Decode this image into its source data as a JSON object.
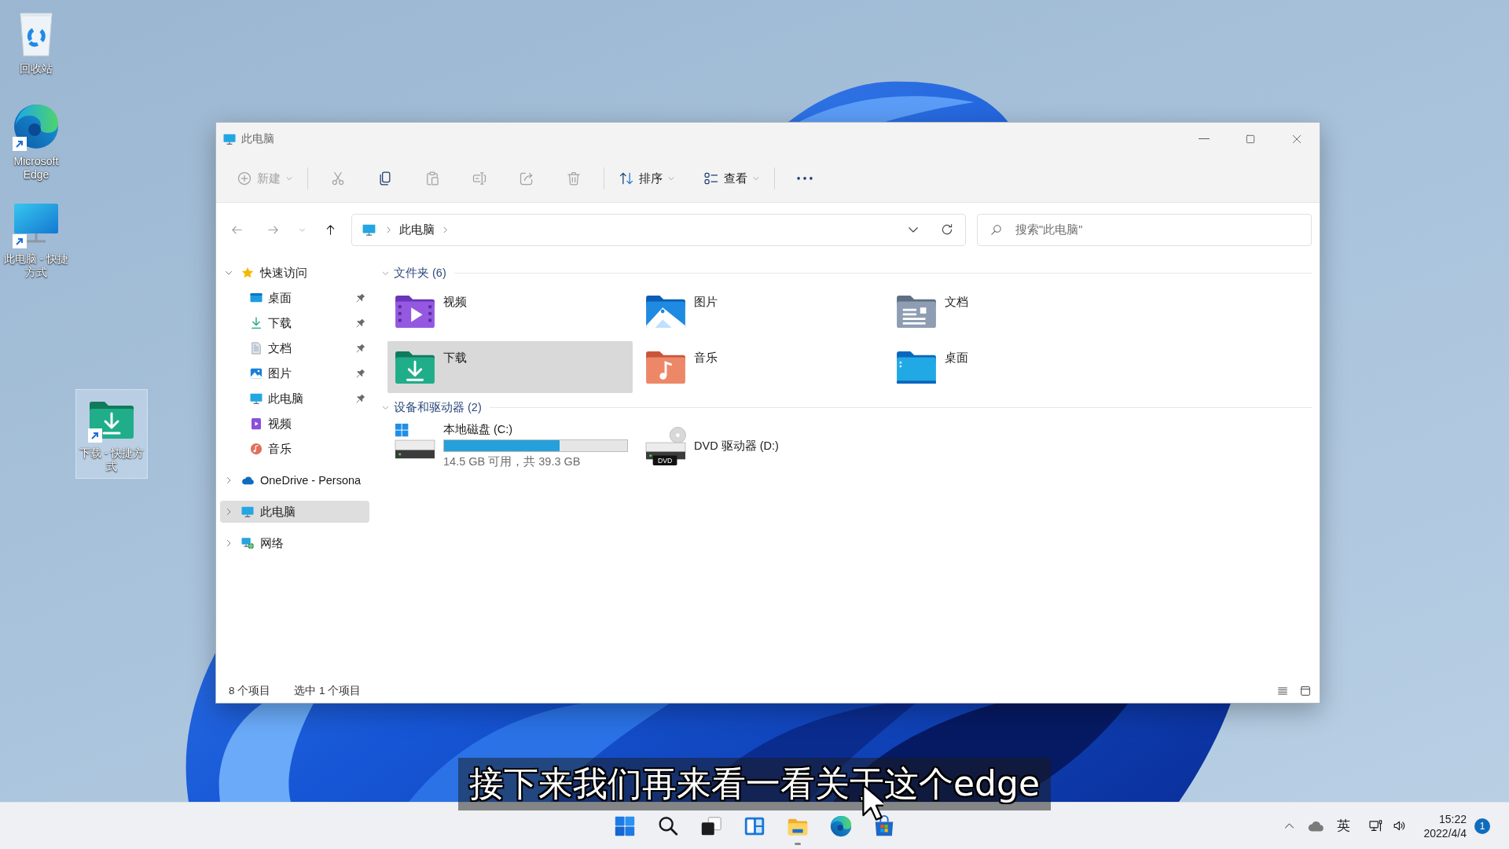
{
  "desktop": {
    "icons": [
      {
        "label": "回收站",
        "kind": "recycle-bin",
        "shortcut": false,
        "selected": false
      },
      {
        "label": "Microsoft Edge",
        "kind": "edge",
        "shortcut": true,
        "selected": false
      },
      {
        "label": "此电脑 - 快捷方式",
        "kind": "pc",
        "shortcut": true,
        "selected": false
      },
      {
        "label": "下载 - 快捷方式",
        "kind": "downloads",
        "shortcut": true,
        "selected": true
      }
    ]
  },
  "window": {
    "title": "此电脑",
    "controls": [
      {
        "kind": "minimize"
      },
      {
        "kind": "maximize"
      },
      {
        "kind": "close"
      }
    ],
    "toolbar": [
      {
        "buttons": [
          {
            "kind": "new",
            "label": "新建",
            "dropdown": true,
            "disabled": true
          }
        ]
      },
      {
        "buttons": [
          {
            "kind": "cut",
            "disabled": true
          },
          {
            "kind": "copy",
            "disabled": false
          },
          {
            "kind": "paste",
            "disabled": true
          },
          {
            "kind": "rename",
            "disabled": true
          },
          {
            "kind": "share",
            "disabled": true
          },
          {
            "kind": "delete",
            "disabled": true
          }
        ]
      },
      {
        "buttons": [
          {
            "kind": "sort",
            "label": "排序",
            "dropdown": true,
            "disabled": false
          },
          {
            "kind": "view",
            "label": "查看",
            "dropdown": true,
            "disabled": false
          }
        ]
      },
      {
        "buttons": [
          {
            "kind": "more",
            "disabled": false
          }
        ]
      }
    ],
    "nav": [
      {
        "kind": "back",
        "disabled": true
      },
      {
        "kind": "forward",
        "disabled": true
      },
      {
        "kind": "recent",
        "disabled": true
      },
      {
        "kind": "up",
        "disabled": false
      }
    ],
    "address": {
      "path": [
        "此电脑"
      ]
    },
    "search": {
      "placeholder": "搜索\"此电脑\""
    },
    "sidebar": {
      "items": [
        {
          "label": "快速访问",
          "kind": "star",
          "expanded": true,
          "selected": false,
          "children": [
            {
              "label": "桌面",
              "kind": "desktop",
              "pinned": true,
              "selected": false
            },
            {
              "label": "下载",
              "kind": "downloads",
              "pinned": true,
              "selected": false
            },
            {
              "label": "文档",
              "kind": "documents",
              "pinned": true,
              "selected": false
            },
            {
              "label": "图片",
              "kind": "pictures",
              "pinned": true,
              "selected": false
            },
            {
              "label": "此电脑",
              "kind": "pc",
              "pinned": true,
              "selected": false
            },
            {
              "label": "视频",
              "kind": "videos",
              "pinned": false,
              "selected": false
            },
            {
              "label": "音乐",
              "kind": "music",
              "pinned": false,
              "selected": false
            }
          ]
        },
        {
          "label": "OneDrive - Persona",
          "kind": "onedrive",
          "expanded": false,
          "selected": false
        },
        {
          "label": "此电脑",
          "kind": "pc",
          "expanded": false,
          "selected": true
        },
        {
          "label": "网络",
          "kind": "network",
          "expanded": false,
          "selected": false
        }
      ]
    },
    "content": {
      "groups": [
        {
          "title": "文件夹 (6)",
          "expanded": true,
          "items": [
            {
              "label": "视频",
              "kind": "videos",
              "selected": false
            },
            {
              "label": "图片",
              "kind": "pictures",
              "selected": false
            },
            {
              "label": "文档",
              "kind": "documents",
              "selected": false
            },
            {
              "label": "下载",
              "kind": "downloads",
              "selected": true
            },
            {
              "label": "音乐",
              "kind": "music",
              "selected": false
            },
            {
              "label": "桌面",
              "kind": "desktop",
              "selected": false
            }
          ]
        },
        {
          "title": "设备和驱动器 (2)",
          "expanded": true,
          "items": [
            {
              "label": "本地磁盘 (C:)",
              "kind": "disk",
              "level": 0.63,
              "detail": "14.5 GB 可用，共 39.3 GB",
              "selected": false
            },
            {
              "label": "DVD 驱动器 (D:)",
              "kind": "dvd",
              "badge": "DVD",
              "selected": false
            }
          ]
        }
      ]
    },
    "status_bar": {
      "item_count": "8 个项目",
      "selection": "选中 1 个项目",
      "views": [
        {
          "kind": "details"
        },
        {
          "kind": "large-icons"
        }
      ]
    }
  },
  "taskbar": {
    "apps": [
      {
        "kind": "start",
        "running": false
      },
      {
        "kind": "search",
        "running": false
      },
      {
        "kind": "task-view",
        "running": false
      },
      {
        "kind": "widgets",
        "running": false
      },
      {
        "kind": "file-explorer",
        "running": true
      },
      {
        "kind": "edge",
        "running": false
      },
      {
        "kind": "store",
        "running": false
      }
    ],
    "tray": [
      {
        "kind": "chevron"
      },
      {
        "kind": "onedrive"
      },
      {
        "kind": "input-method",
        "label": "英"
      },
      {
        "kind": "network"
      },
      {
        "kind": "volume"
      }
    ],
    "clock": {
      "time": "15:22",
      "date": "2022/4/4"
    },
    "notifications": "1"
  },
  "subtitle": "接下来我们再来看一看关于这个edge"
}
